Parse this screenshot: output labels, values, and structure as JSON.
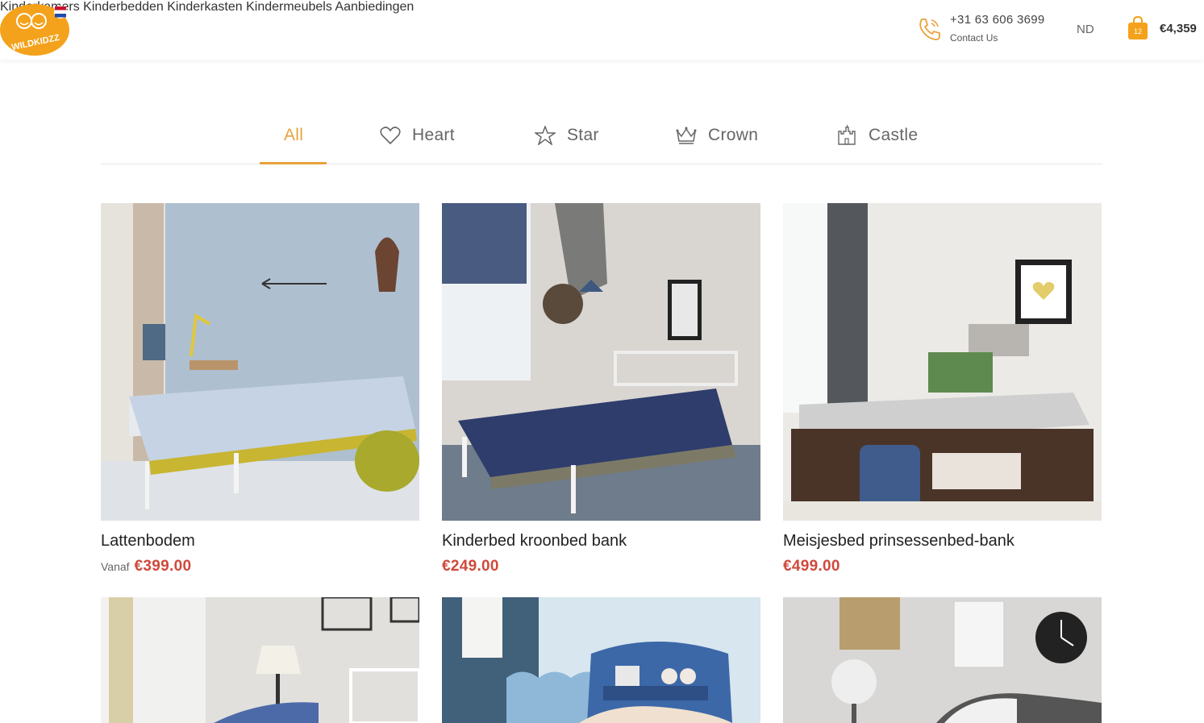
{
  "brand": {
    "logo_text": "WILDKIDZZ",
    "accent": "#e8a23b",
    "price_color": "#cf4a3b"
  },
  "nav": {
    "items": [
      "Kinderkamers",
      "Kinderbedden",
      "Kinderkasten",
      "Kindermeubels",
      "Aanbiedingen"
    ]
  },
  "contact": {
    "phone": "+31 63 606 3699",
    "label": "Contact Us",
    "icon": "phone-icon"
  },
  "lang": "ND",
  "cart": {
    "count": "12",
    "total": "€4,359",
    "icon": "shopping-bag-icon"
  },
  "tabs": [
    {
      "label": "All",
      "icon": "",
      "active": true
    },
    {
      "label": "Heart",
      "icon": "heart-icon"
    },
    {
      "label": "Star",
      "icon": "star-icon"
    },
    {
      "label": "Crown",
      "icon": "crown-icon"
    },
    {
      "label": "Castle",
      "icon": "castle-icon"
    }
  ],
  "products": [
    {
      "title": "Lattenbodem",
      "prefix": "Vanaf",
      "price": "€399.00"
    },
    {
      "title": "Kinderbed kroonbed bank",
      "prefix": "",
      "price": "€249.00"
    },
    {
      "title": "Meisjesbed prinsessenbed-bank",
      "prefix": "",
      "price": "€499.00"
    },
    {
      "title": "",
      "prefix": "",
      "price": ""
    },
    {
      "title": "",
      "prefix": "",
      "price": ""
    },
    {
      "title": "",
      "prefix": "",
      "price": ""
    }
  ]
}
